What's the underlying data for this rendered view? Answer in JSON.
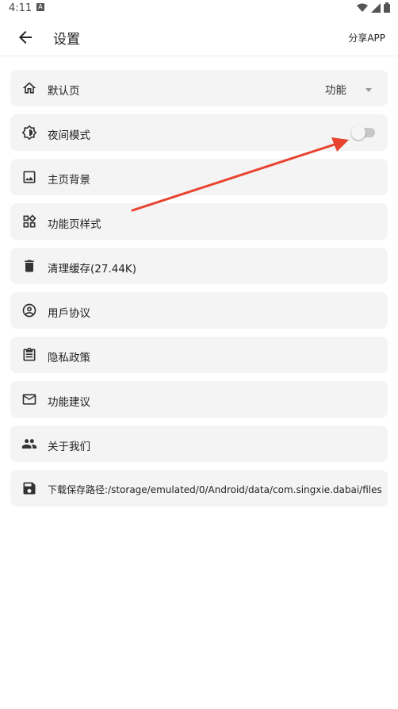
{
  "status_bar": {
    "time": "4:11",
    "notification_badge": "A"
  },
  "app_bar": {
    "back_icon": "arrow-left-icon",
    "title": "设置",
    "share_label": "分享APP"
  },
  "settings": [
    {
      "key": "default-page",
      "icon": "home-icon",
      "label": "默认页",
      "value": "功能"
    },
    {
      "key": "night-mode",
      "icon": "brightness-icon",
      "label": "夜间模式",
      "toggle_on": false
    },
    {
      "key": "home-background",
      "icon": "image-icon",
      "label": "主页背景"
    },
    {
      "key": "feature-page-style",
      "icon": "widgets-icon",
      "label": "功能页样式"
    },
    {
      "key": "clear-cache",
      "icon": "trash-icon",
      "label": "清理缓存(27.44K)"
    },
    {
      "key": "user-agreement",
      "icon": "account-circle-icon",
      "label": "用戶协议"
    },
    {
      "key": "privacy-policy",
      "icon": "clipboard-icon",
      "label": "隐私政策"
    },
    {
      "key": "feedback",
      "icon": "mail-icon",
      "label": "功能建议"
    },
    {
      "key": "about-us",
      "icon": "people-icon",
      "label": "关于我们"
    },
    {
      "key": "download-path",
      "icon": "save-icon",
      "label": "下载保存路径:/storage/emulated/0/Android/data/com.singxie.dabai/files"
    }
  ],
  "colors": {
    "annotation_arrow": "#e8432f",
    "row_background": "#f4f4f4"
  }
}
